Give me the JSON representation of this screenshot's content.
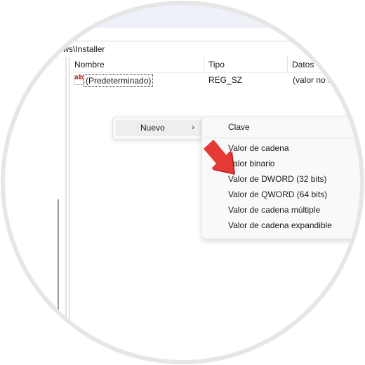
{
  "address": {
    "path": "dows\\Installer"
  },
  "list": {
    "columns": {
      "name": "Nombre",
      "type": "Tipo",
      "data": "Datos"
    },
    "rows": [
      {
        "icon": "ab",
        "name": "(Predeterminado)",
        "type": "REG_SZ",
        "data": "(valor no e"
      }
    ]
  },
  "context_menu": {
    "item_label": "Nuevo",
    "chevron": "›"
  },
  "submenu": {
    "items": [
      "Clave",
      "Valor de cadena",
      "Valor binario",
      "Valor de DWORD (32 bits)",
      "Valor de QWORD (64 bits)",
      "Valor de cadena múltiple",
      "Valor de cadena expandible"
    ]
  },
  "colors": {
    "arrow": "#e53935",
    "arrow_dark": "#b71c1c",
    "frame": "#e6e6e6"
  },
  "icons": {
    "value_icon": "string-value-icon",
    "pointer": "red-arrow-icon"
  }
}
